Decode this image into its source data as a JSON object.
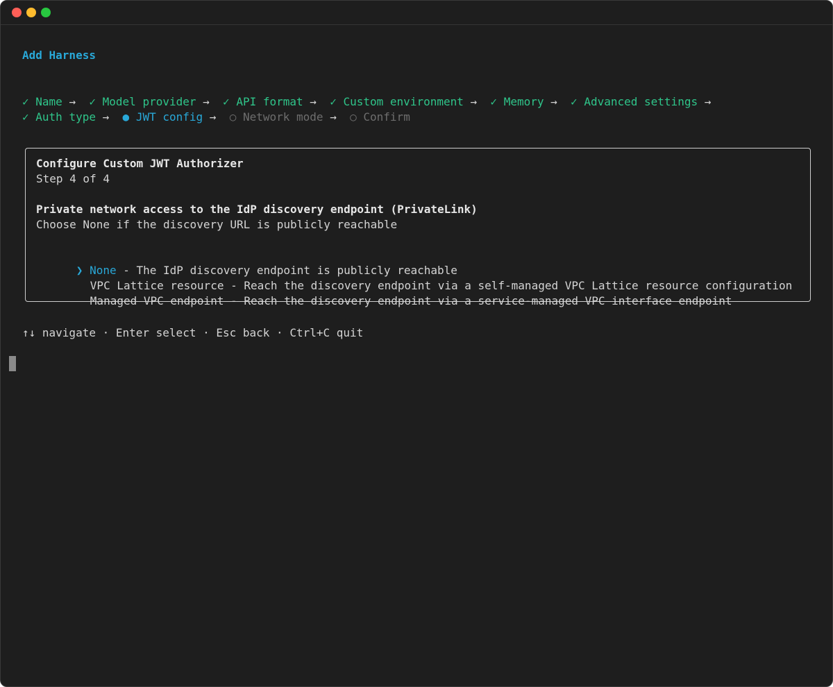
{
  "window": {
    "title_dots": [
      "close",
      "minimize",
      "zoom"
    ]
  },
  "header": {
    "title": "Add Harness"
  },
  "steps": {
    "check_glyph": "✓",
    "active_glyph": "●",
    "pending_glyph": "○",
    "arrow_glyph": "→",
    "items": [
      {
        "label": "Name",
        "state": "done"
      },
      {
        "label": "Model provider",
        "state": "done"
      },
      {
        "label": "API format",
        "state": "done"
      },
      {
        "label": "Custom environment",
        "state": "done"
      },
      {
        "label": "Memory",
        "state": "done"
      },
      {
        "label": "Advanced settings",
        "state": "done"
      },
      {
        "label": "Auth type",
        "state": "done"
      },
      {
        "label": "JWT config",
        "state": "active"
      },
      {
        "label": "Network mode",
        "state": "pending"
      },
      {
        "label": "Confirm",
        "state": "pending"
      }
    ]
  },
  "panel": {
    "heading": "Configure Custom JWT Authorizer",
    "step": "Step 4 of 4",
    "question": "Private network access to the IdP discovery endpoint (PrivateLink)",
    "hint": "Choose None if the discovery URL is publicly reachable",
    "pointer": "❯",
    "options": [
      {
        "name": "None",
        "description": " - The IdP discovery endpoint is publicly reachable",
        "selected": true
      },
      {
        "name": "VPC Lattice resource",
        "description": " - Reach the discovery endpoint via a self-managed VPC Lattice resource configuration",
        "selected": false
      },
      {
        "name": "Managed VPC endpoint",
        "description": " - Reach the discovery endpoint via a service-managed VPC interface endpoint",
        "selected": false
      }
    ]
  },
  "footer": {
    "help": "↑↓ navigate · Enter select · Esc back · Ctrl+C quit"
  },
  "colors": {
    "background": "#1e1e1e",
    "accent": "#29a8d8",
    "done": "#2fc58a",
    "pending": "#6e6e6e",
    "text": "#d4d4d4"
  }
}
